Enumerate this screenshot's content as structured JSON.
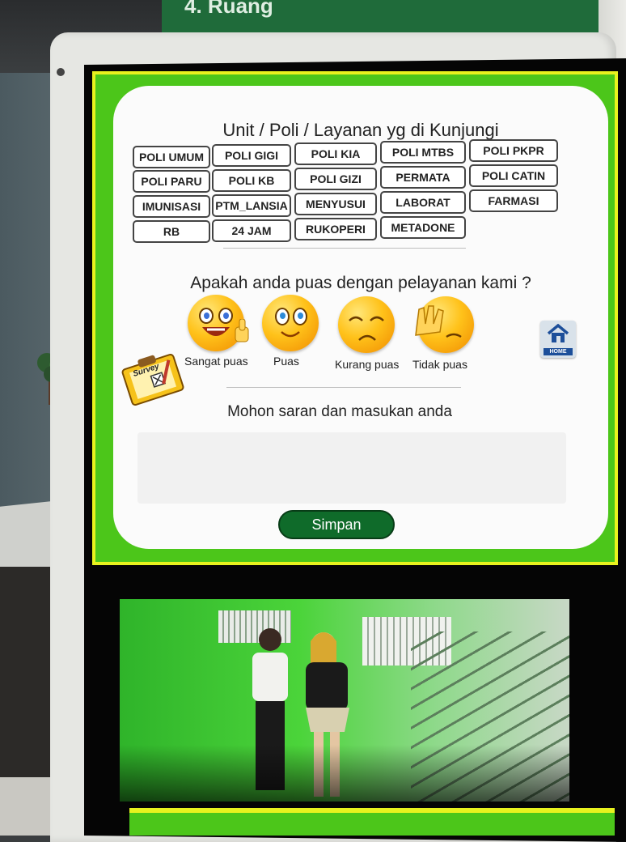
{
  "sign": {
    "text": "4. Ruang"
  },
  "kiosk": {
    "title": "Unit / Poli / Layanan yg di Kunjungi",
    "units": [
      "POLI UMUM",
      "POLI GIGI",
      "POLI KIA",
      "POLI MTBS",
      "POLI PKPR",
      "POLI PARU",
      "POLI KB",
      "POLI GIZI",
      "PERMATA",
      "POLI CATIN",
      "IMUNISASI",
      "PTM_LANSIA",
      "MENYUSUI",
      "LABORAT",
      "FARMASI",
      "RB",
      "24 JAM",
      "RUKOPERI",
      "METADONE"
    ],
    "question": "Apakah anda puas dengan pelayanan kami ?",
    "ratings": [
      {
        "label": "Sangat puas",
        "icon": "very-happy-face-icon"
      },
      {
        "label": "Puas",
        "icon": "happy-face-icon"
      },
      {
        "label": "Kurang puas",
        "icon": "sad-face-icon"
      },
      {
        "label": "Tidak puas",
        "icon": "facepalm-face-icon"
      }
    ],
    "home_label": "HOME",
    "survey_label": "Survey",
    "feedback_prompt": "Mohon saran dan masukan anda",
    "submit_label": "Simpan"
  },
  "colors": {
    "kiosk_green": "#4cc61a",
    "accent_yellow": "#e8f21e",
    "button_dark_green": "#0f6b2a"
  }
}
